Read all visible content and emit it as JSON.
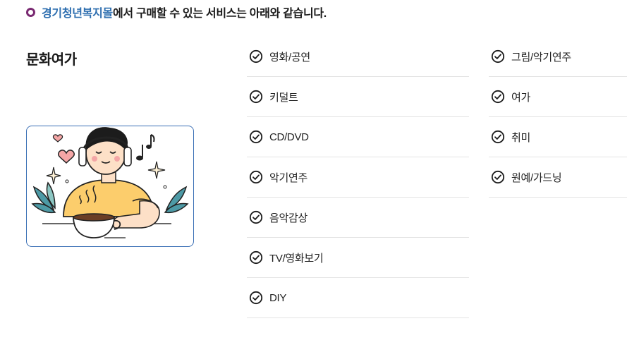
{
  "intro": {
    "brand": "경기청년복지몰",
    "rest": "에서 구매할 수 있는 서비스는 아래와 같습니다."
  },
  "section": {
    "title": "문화여가"
  },
  "illustration": {
    "icon": "person-with-headphones-and-coffee"
  },
  "services": {
    "col1": [
      {
        "label": "영화/공연"
      },
      {
        "label": "키덜트"
      },
      {
        "label": "CD/DVD"
      },
      {
        "label": "악기연주"
      },
      {
        "label": "음악감상"
      },
      {
        "label": "TV/영화보기"
      },
      {
        "label": "DIY"
      }
    ],
    "col2": [
      {
        "label": "그림/악기연주"
      },
      {
        "label": "여가"
      },
      {
        "label": "취미"
      },
      {
        "label": "원예/가드닝"
      }
    ]
  },
  "colors": {
    "brand": "#2f6fb0",
    "bullet": "#7a2a72",
    "card_border": "#3a6fb5"
  }
}
